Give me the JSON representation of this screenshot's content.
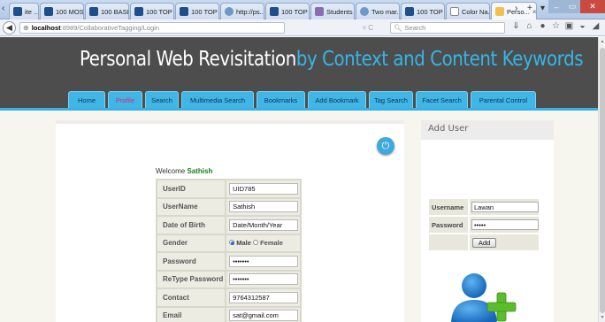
{
  "browser": {
    "tabs": [
      {
        "label": "ite ...",
        "fav": "n"
      },
      {
        "label": "100 MOS...",
        "fav": "n"
      },
      {
        "label": "100 BASI...",
        "fav": "n"
      },
      {
        "label": "100 TOP ...",
        "fav": "n"
      },
      {
        "label": "100 TOP ...",
        "fav": "n"
      },
      {
        "label": "http://ps...",
        "fav": "g"
      },
      {
        "label": "100 TOP ...",
        "fav": "n"
      },
      {
        "label": "Students ...",
        "fav": "s"
      },
      {
        "label": "Two mar...",
        "fav": "g"
      },
      {
        "label": "100 TOP ...",
        "fav": "n"
      },
      {
        "label": "Color Na...",
        "fav": "w"
      },
      {
        "label": "Perso...",
        "fav": "y",
        "active": true
      }
    ],
    "tab_close": "×",
    "new_tab": "+",
    "address_host": "localhost",
    "address_path": ":8989/CollaborativeTagging/Login",
    "search_placeholder": "Search"
  },
  "site": {
    "title_part1": "Personal Web Revisitation",
    "title_part2": "by Context and Content Keywords",
    "menu": [
      {
        "label": "Home",
        "width": 42
      },
      {
        "label": "Profile",
        "width": 39,
        "active": true
      },
      {
        "label": "Search",
        "width": 38
      },
      {
        "label": "Multimedia Search",
        "width": 82
      },
      {
        "label": "Bookmarks",
        "width": 55
      },
      {
        "label": "Add Bookmark",
        "width": 66
      },
      {
        "label": "Tag Search",
        "width": 50
      },
      {
        "label": "Facet Search",
        "width": 59
      },
      {
        "label": "Parental Control",
        "width": 74
      }
    ]
  },
  "profile": {
    "welcome_text": "Welcome",
    "welcome_user": "Sathish",
    "fields": [
      {
        "label": "UserID",
        "value": "UID785"
      },
      {
        "label": "UserName",
        "value": "Sathish"
      },
      {
        "label": "Date of Birth",
        "value": "Date/Month/Year"
      },
      {
        "label": "Gender",
        "male": "Male",
        "female": "Female"
      },
      {
        "label": "Password",
        "value": "•••••••"
      },
      {
        "label": "ReType Password",
        "value": "•••••••"
      },
      {
        "label": "Contact",
        "value": "9764312587"
      },
      {
        "label": "Email",
        "value": "sat@gmail.com"
      }
    ]
  },
  "add_user": {
    "title": "Add User",
    "username_label": "Username",
    "username_value": "Lawan",
    "password_label": "Password",
    "password_value": "•••••",
    "button_label": "Add"
  }
}
